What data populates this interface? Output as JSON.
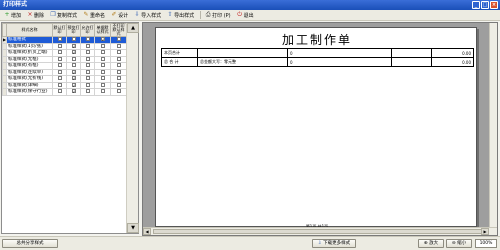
{
  "window": {
    "title": "打印样式",
    "min": "_",
    "max": "□",
    "close": "×"
  },
  "toolbar": [
    {
      "icon": "add-icon",
      "glyph": "+",
      "color": "#2a9a2a",
      "label": "增加"
    },
    {
      "icon": "delete-icon",
      "glyph": "×",
      "color": "#c02020",
      "label": "删除"
    },
    {
      "icon": "copy-style-icon",
      "glyph": "❐",
      "color": "#2d5bb0",
      "label": "复制样式"
    },
    {
      "icon": "rename-icon",
      "glyph": "✎",
      "color": "#b07a18",
      "label": "重命名"
    },
    {
      "icon": "design-icon",
      "glyph": "✐",
      "color": "#b07a18",
      "label": "设计"
    },
    {
      "icon": "import-style-icon",
      "glyph": "⇩",
      "color": "#2d5bb0",
      "label": "导入样式"
    },
    {
      "icon": "export-style-icon",
      "glyph": "⇧",
      "color": "#2d5bb0",
      "label": "导出样式"
    },
    {
      "icon": "print-icon",
      "glyph": "⎙",
      "color": "#444444",
      "label": "打印 (P)"
    },
    {
      "icon": "exit-icon",
      "glyph": "⏻",
      "color": "#c02020",
      "label": "退出"
    }
  ],
  "styles_table": {
    "headers": [
      "样式名称",
      "默认打印",
      "预览打印",
      "允许打印",
      "单据默认样式",
      "不打印默认样式"
    ],
    "rows": [
      {
        "name": "标准格式",
        "checks": [
          false,
          false,
          false,
          true,
          false
        ],
        "selected": true
      },
      {
        "name": "标准样式(1页/张)",
        "checks": [
          false,
          true,
          false,
          false,
          false
        ],
        "selected": false
      },
      {
        "name": "标准样式(折页上端)",
        "checks": [
          false,
          true,
          false,
          false,
          false
        ],
        "selected": false
      },
      {
        "name": "标准样式(无框)",
        "checks": [
          false,
          false,
          false,
          false,
          false
        ],
        "selected": false
      },
      {
        "name": "标准样式(有框)",
        "checks": [
          false,
          false,
          false,
          false,
          false
        ],
        "selected": false
      },
      {
        "name": "标准样式(连续单)",
        "checks": [
          false,
          true,
          false,
          false,
          false
        ],
        "selected": false
      },
      {
        "name": "标准样式(无折线)",
        "checks": [
          false,
          true,
          false,
          false,
          false
        ],
        "selected": false
      },
      {
        "name": "标准样式(详细)",
        "checks": [
          false,
          true,
          false,
          false,
          false
        ],
        "selected": false
      },
      {
        "name": "标准样式(保守行业)",
        "checks": [
          false,
          true,
          false,
          false,
          false
        ],
        "selected": false
      }
    ]
  },
  "preview": {
    "title": "加工制作单",
    "rows": [
      {
        "label": "本页合计",
        "c2": "",
        "c3": "0",
        "c4": "",
        "c5": "0.00"
      },
      {
        "label": "总 合 计",
        "c2": "总金额大写：零元整",
        "c3": "0",
        "c4": "",
        "c5": "0.00"
      }
    ],
    "footer": "第1页 共1页"
  },
  "statusbar": {
    "share_style": "总共分享样式",
    "download_more": "下载更多样式",
    "zoom_in": "放大",
    "zoom_out": "缩小",
    "zoom": "100%"
  }
}
